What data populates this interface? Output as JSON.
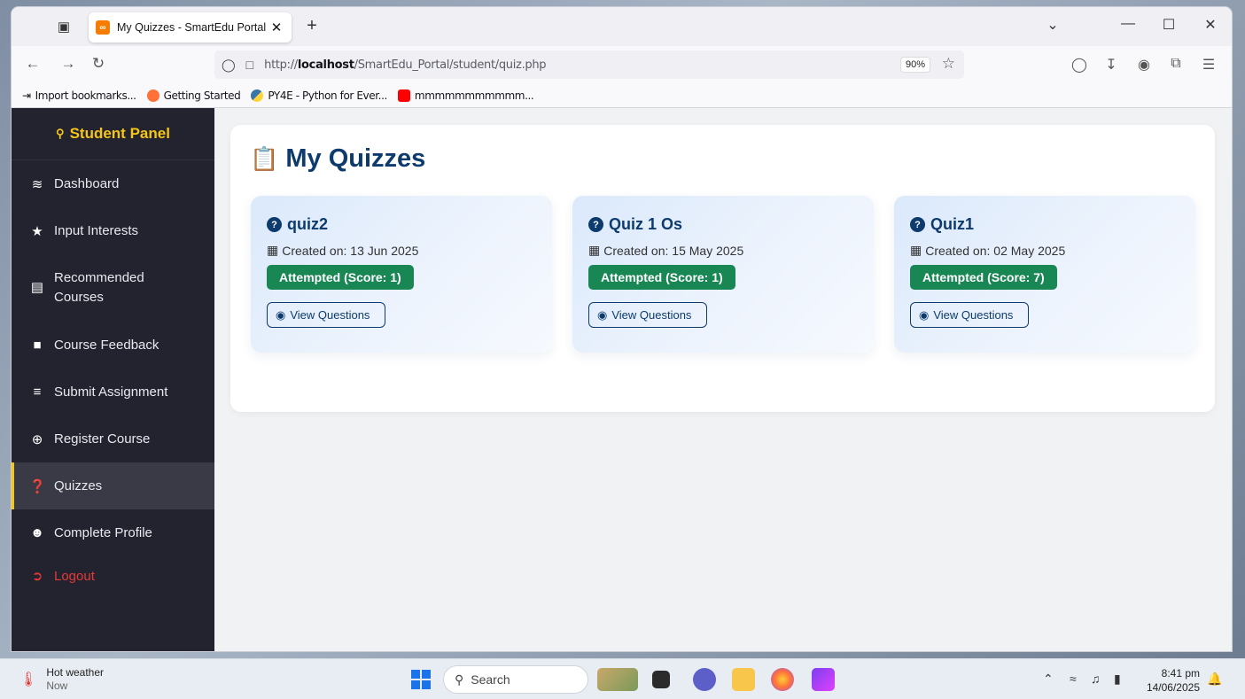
{
  "browser": {
    "tab_title": "My Quizzes - SmartEdu Portal",
    "url_prefix": "http://",
    "url_host": "localhost",
    "url_path": "/SmartEdu_Portal/student/quiz.php",
    "zoom": "90%",
    "bookmarks": [
      "Import bookmarks...",
      "Getting Started",
      "PY4E - Python for Ever...",
      "mmmmmmmmmmm..."
    ]
  },
  "sidebar": {
    "title": "Student Panel",
    "items": [
      {
        "label": "Dashboard",
        "icon": "chart-line-icon"
      },
      {
        "label": "Input Interests",
        "icon": "star-icon"
      },
      {
        "label": "Recommended Courses",
        "icon": "book-icon"
      },
      {
        "label": "Course Feedback",
        "icon": "comment-icon"
      },
      {
        "label": "Submit Assignment",
        "icon": "tasks-icon"
      },
      {
        "label": "Register Course",
        "icon": "plus-circle-icon"
      },
      {
        "label": "Quizzes",
        "icon": "question-circle-icon",
        "active": true
      },
      {
        "label": "Complete Profile",
        "icon": "user-edit-icon"
      },
      {
        "label": "Logout",
        "icon": "sign-out-icon"
      }
    ]
  },
  "main": {
    "title": "My Quizzes",
    "quizzes": [
      {
        "title": "quiz2",
        "date": "Created on: 13 Jun 2025",
        "status": "Attempted (Score: 1)",
        "button": "View Questions"
      },
      {
        "title": "Quiz 1 Os",
        "date": "Created on: 15 May 2025",
        "status": "Attempted (Score: 1)",
        "button": "View Questions"
      },
      {
        "title": "Quiz1",
        "date": "Created on: 02 May 2025",
        "status": "Attempted (Score: 7)",
        "button": "View Questions"
      }
    ]
  },
  "taskbar": {
    "weather_title": "Hot weather",
    "weather_sub": "Now",
    "search_placeholder": "Search",
    "time": "8:41 pm",
    "date": "14/06/2025"
  },
  "colors": {
    "sidebar_bg": "#23232f",
    "accent": "#f5c518",
    "primary": "#0d3b6e",
    "success": "#198754",
    "logout": "#e53935"
  }
}
